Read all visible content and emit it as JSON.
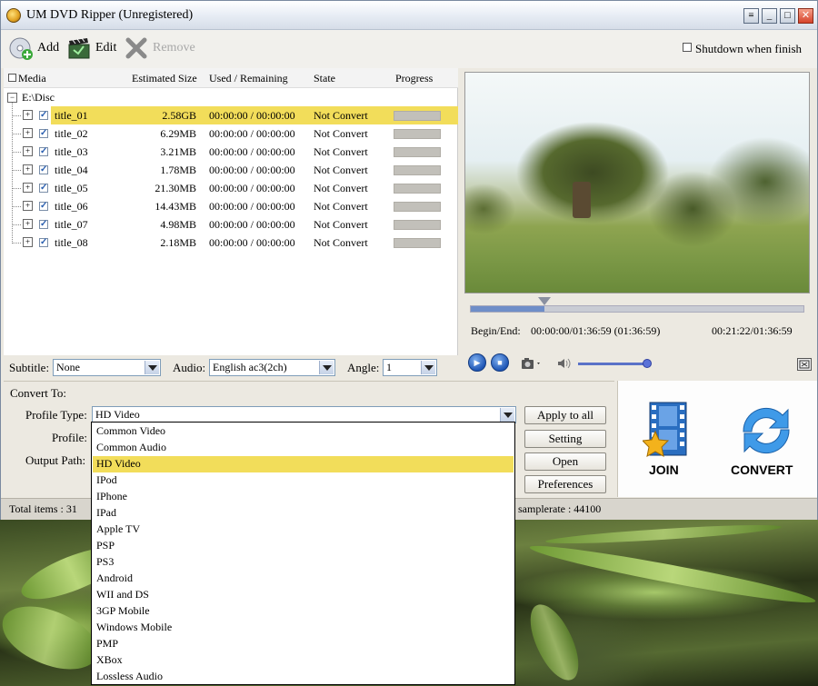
{
  "window": {
    "title": "UM DVD Ripper  (Unregistered)"
  },
  "toolbar": {
    "add_label": "Add",
    "edit_label": "Edit",
    "remove_label": "Remove",
    "shutdown_label": "Shutdown when finish",
    "shutdown_checked": false
  },
  "media_list": {
    "columns": [
      "Media",
      "Estimated Size",
      "Used / Remaining",
      "State",
      "Progress"
    ],
    "root": "E:\\Disc",
    "rows": [
      {
        "name": "title_01",
        "size": "2.58GB",
        "time": "00:00:00 / 00:00:00",
        "state": "Not Convert",
        "progress": 0,
        "selected": true
      },
      {
        "name": "title_02",
        "size": "6.29MB",
        "time": "00:00:00 / 00:00:00",
        "state": "Not Convert",
        "progress": 0,
        "selected": false
      },
      {
        "name": "title_03",
        "size": "3.21MB",
        "time": "00:00:00 / 00:00:00",
        "state": "Not Convert",
        "progress": 0,
        "selected": false
      },
      {
        "name": "title_04",
        "size": "1.78MB",
        "time": "00:00:00 / 00:00:00",
        "state": "Not Convert",
        "progress": 0,
        "selected": false
      },
      {
        "name": "title_05",
        "size": "21.30MB",
        "time": "00:00:00 / 00:00:00",
        "state": "Not Convert",
        "progress": 0,
        "selected": false
      },
      {
        "name": "title_06",
        "size": "14.43MB",
        "time": "00:00:00 / 00:00:00",
        "state": "Not Convert",
        "progress": 0,
        "selected": false
      },
      {
        "name": "title_07",
        "size": "4.98MB",
        "time": "00:00:00 / 00:00:00",
        "state": "Not Convert",
        "progress": 0,
        "selected": false
      },
      {
        "name": "title_08",
        "size": "2.18MB",
        "time": "00:00:00 / 00:00:00",
        "state": "Not Convert",
        "progress": 0,
        "selected": false
      }
    ]
  },
  "player": {
    "begin_end_label": "Begin/End:",
    "begin_end_value": "00:00:00/01:36:59 (01:36:59)",
    "current_time": "00:21:22/01:36:59",
    "seek_position": 0.22,
    "volume": 0.95
  },
  "tracks": {
    "subtitle_label": "Subtitle:",
    "subtitle_value": "None",
    "audio_label": "Audio:",
    "audio_value": "English ac3(2ch)",
    "angle_label": "Angle:",
    "angle_value": "1"
  },
  "convert": {
    "section_label": "Convert To:",
    "profile_type_label": "Profile Type:",
    "profile_type_value": "HD Video",
    "profile_label": "Profile:",
    "output_path_label": "Output Path:",
    "apply_to_all": "Apply to all",
    "setting": "Setting",
    "open": "Open",
    "preferences": "Preferences"
  },
  "big_buttons": {
    "join": "JOIN",
    "convert": "CONVERT"
  },
  "status": {
    "total_items": "Total items : 31",
    "samplerate": "samplerate : 44100"
  },
  "dropdown": {
    "options": [
      "Common Video",
      "Common Audio",
      "HD Video",
      "IPod",
      "IPhone",
      "IPad",
      "Apple TV",
      "PSP",
      "PS3",
      "Android",
      "WII and DS",
      "3GP Mobile",
      "Windows Mobile",
      "PMP",
      "XBox",
      "Lossless Audio"
    ],
    "selected_index": 2
  },
  "colors": {
    "selection": "#f2dd5a",
    "accent_blue": "#1f56b5"
  }
}
